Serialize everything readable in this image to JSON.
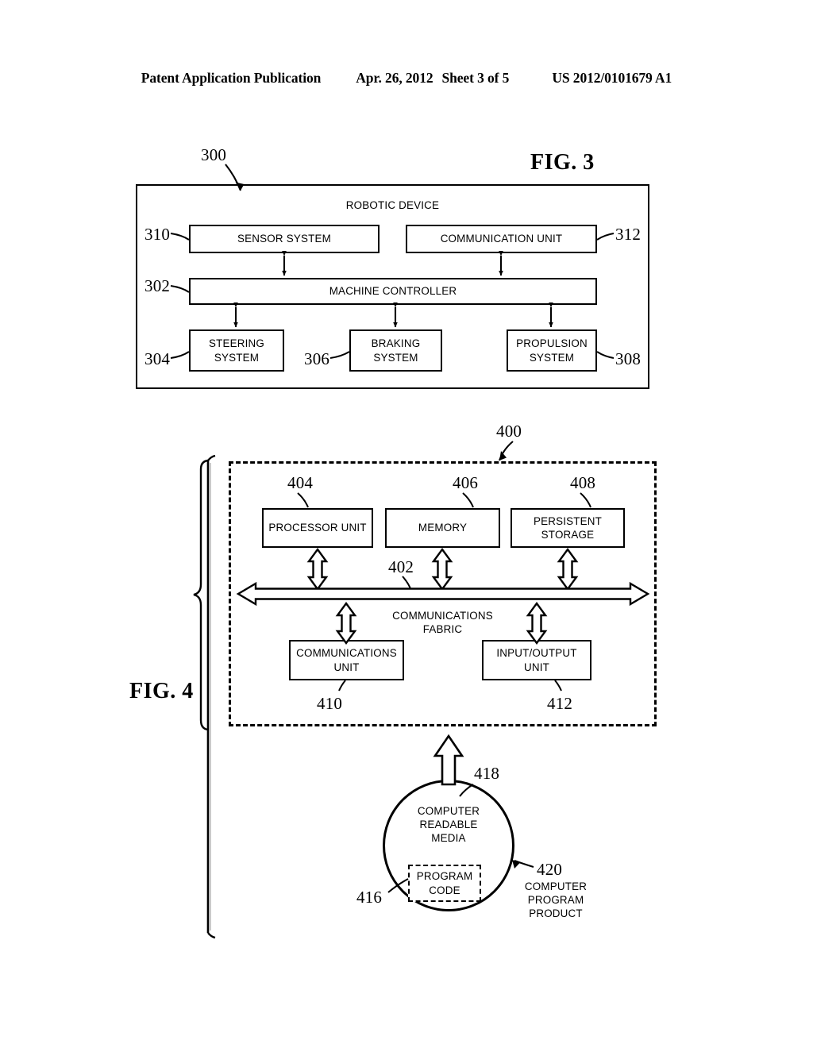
{
  "header": {
    "publication": "Patent Application Publication",
    "date": "Apr. 26, 2012",
    "sheet": "Sheet 3 of 5",
    "number": "US 2012/0101679 A1"
  },
  "figure3": {
    "title": "FIG. 3",
    "ref": "300",
    "container_label": "ROBOTIC DEVICE",
    "blocks": [
      {
        "ref": "310",
        "label": "SENSOR SYSTEM"
      },
      {
        "ref": "312",
        "label": "COMMUNICATION UNIT"
      },
      {
        "ref": "302",
        "label": "MACHINE CONTROLLER"
      },
      {
        "ref": "304",
        "label": "STEERING\nSYSTEM"
      },
      {
        "ref": "306",
        "label": "BRAKING\nSYSTEM"
      },
      {
        "ref": "308",
        "label": "PROPULSION\nSYSTEM"
      }
    ]
  },
  "figure4": {
    "title": "FIG. 4",
    "ref": "400",
    "fabric_ref": "402",
    "fabric_label": "COMMUNICATIONS\nFABRIC",
    "blocks": [
      {
        "ref": "404",
        "label": "PROCESSOR UNIT"
      },
      {
        "ref": "406",
        "label": "MEMORY"
      },
      {
        "ref": "408",
        "label": "PERSISTENT\nSTORAGE"
      },
      {
        "ref": "410",
        "label": "COMMUNICATIONS\nUNIT"
      },
      {
        "ref": "412",
        "label": "INPUT/OUTPUT\nUNIT"
      }
    ],
    "media": {
      "ref": "418",
      "label": "COMPUTER\nREADABLE\nMEDIA",
      "program_code_ref": "416",
      "program_code_label": "PROGRAM\nCODE",
      "product_ref": "420",
      "product_label": "COMPUTER\nPROGRAM\nPRODUCT"
    }
  }
}
